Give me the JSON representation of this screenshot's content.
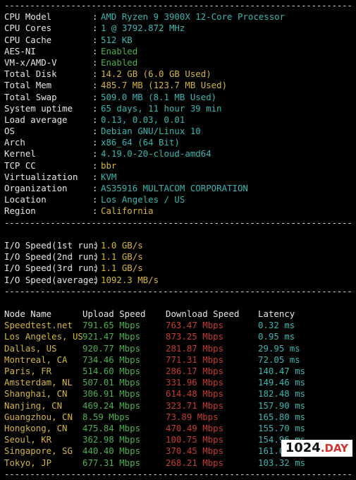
{
  "colors": {
    "background": "#000000",
    "text": "#e6e6e6",
    "cyan": "#39b6b0",
    "green": "#4caf50",
    "yellow": "#d4b63c",
    "red": "#c53b33"
  },
  "divider": "----------------------------------------------------------------------",
  "system_info": [
    {
      "key": "CPU Model",
      "value": "AMD Ryzen 9 3900X 12-Core Processor",
      "color": "cyan"
    },
    {
      "key": "CPU Cores",
      "value": "1 @ 3792.872 MHz",
      "color": "cyan"
    },
    {
      "key": "CPU Cache",
      "value": "512 KB",
      "color": "cyan"
    },
    {
      "key": "AES-NI",
      "value": "Enabled",
      "color": "green"
    },
    {
      "key": "VM-x/AMD-V",
      "value": "Enabled",
      "color": "green"
    },
    {
      "key": "Total Disk",
      "value": "14.2 GB (6.0 GB Used)",
      "color": "yellow"
    },
    {
      "key": "Total Mem",
      "value": "485.7 MB (123.7 MB Used)",
      "color": "yellow"
    },
    {
      "key": "Total Swap",
      "value": "509.0 MB (8.1 MB Used)",
      "color": "cyan"
    },
    {
      "key": "System uptime",
      "value": "65 days, 11 hour 39 min",
      "color": "cyan"
    },
    {
      "key": "Load average",
      "value": "0.13, 0.03, 0.01",
      "color": "cyan"
    },
    {
      "key": "OS",
      "value": "Debian GNU/Linux 10",
      "color": "cyan"
    },
    {
      "key": "Arch",
      "value": "x86_64 (64 Bit)",
      "color": "cyan"
    },
    {
      "key": "Kernel",
      "value": "4.19.0-20-cloud-amd64",
      "color": "cyan"
    },
    {
      "key": "TCP CC",
      "value": "bbr",
      "color": "yellow"
    },
    {
      "key": "Virtualization",
      "value": "KVM",
      "color": "cyan"
    },
    {
      "key": "Organization",
      "value": "AS35916 MULTACOM CORPORATION",
      "color": "cyan"
    },
    {
      "key": "Location",
      "value": "Los Angeles / US",
      "color": "cyan"
    },
    {
      "key": "Region",
      "value": "California",
      "color": "yellow"
    }
  ],
  "io_speed": [
    {
      "key": "I/O Speed(1st run)",
      "value": "1.0 GB/s"
    },
    {
      "key": "I/O Speed(2nd run)",
      "value": "1.1 GB/s"
    },
    {
      "key": "I/O Speed(3rd run)",
      "value": "1.1 GB/s"
    },
    {
      "key": "I/O Speed(average)",
      "value": "1092.3 MB/s"
    }
  ],
  "speedtest": {
    "headers": [
      "Node Name",
      "Upload Speed",
      "Download Speed",
      "Latency"
    ],
    "rows": [
      [
        "Speedtest.net",
        "791.65 Mbps",
        "763.47 Mbps",
        "0.32 ms"
      ],
      [
        "Los Angeles, US",
        "921.47 Mbps",
        "873.25 Mbps",
        "0.95 ms"
      ],
      [
        "Dallas, US",
        "920.77 Mbps",
        "281.87 Mbps",
        "29.95 ms"
      ],
      [
        "Montreal, CA",
        "734.46 Mbps",
        "771.31 Mbps",
        "72.05 ms"
      ],
      [
        "Paris, FR",
        "514.60 Mbps",
        "286.17 Mbps",
        "140.47 ms"
      ],
      [
        "Amsterdam, NL",
        "507.01 Mbps",
        "331.96 Mbps",
        "149.46 ms"
      ],
      [
        "Shanghai, CN",
        "306.91 Mbps",
        "614.48 Mbps",
        "182.48 ms"
      ],
      [
        "Nanjing, CN",
        "469.24 Mbps",
        "323.71 Mbps",
        "157.90 ms"
      ],
      [
        "Guangzhou, CN",
        "8.59 Mbps",
        "73.89 Mbps",
        "165.80 ms"
      ],
      [
        "Hongkong, CN",
        "475.84 Mbps",
        "470.49 Mbps",
        "155.70 ms"
      ],
      [
        "Seoul, KR",
        "362.98 Mbps",
        "100.75 Mbps",
        "154.96 ms"
      ],
      [
        "Singapore, SG",
        "440.40 Mbps",
        "370.45 Mbps",
        "161.03 ms"
      ],
      [
        "Tokyo, JP",
        "677.31 Mbps",
        "268.21 Mbps",
        "103.32 ms"
      ]
    ]
  },
  "watermark": {
    "number": "1024",
    "suffix": ".DAY"
  }
}
